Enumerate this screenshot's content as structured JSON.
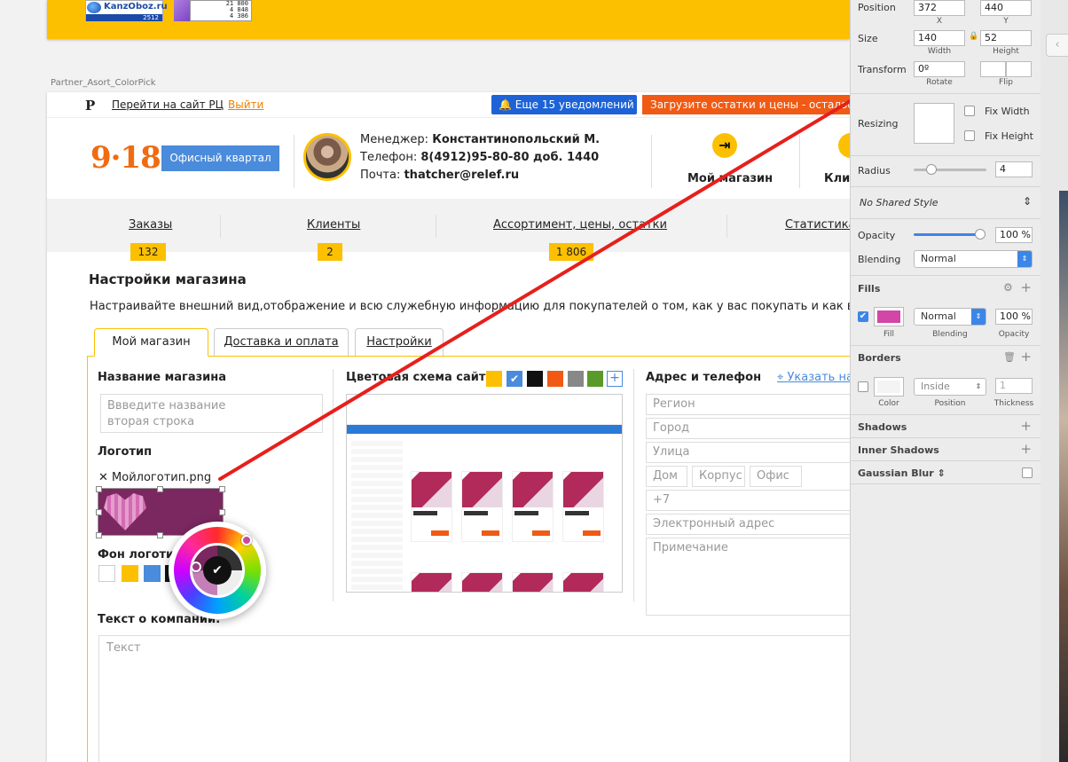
{
  "top_artboard": {
    "kanzoboz_logo": "KanzOboz.ru",
    "kanzoboz_sub": "2512",
    "stats": [
      "21 800",
      "4 848",
      "4 386"
    ]
  },
  "artboard_label": "Partner_Asort_ColorPick",
  "topbar": {
    "logo": "P",
    "goto_link": "Перейти на сайт РЦ",
    "exit_link": "Выйти",
    "notifications": "Еще 15 уведомлений",
    "upload": "Загрузите остатки и цены - осталось"
  },
  "header": {
    "brand": "9·18",
    "office_button": "Офисный квартал",
    "manager_prefix": "Менеджер: ",
    "manager_name": "Константинопольский М.",
    "phone_prefix": "Телефон: ",
    "phone": "8(4912)95-80-80 доб. 1440",
    "email_prefix": "Почта: ",
    "email": "thatcher@relef.ru",
    "my_store": "Мой магазин",
    "clients_short": "Клие"
  },
  "nav": [
    {
      "label": "Заказы",
      "count": "132"
    },
    {
      "label": "Клиенты",
      "count": "2"
    },
    {
      "label": "Ассортимент, цены, остатки",
      "count": "1 806"
    },
    {
      "label": "Статистика",
      "count": ""
    }
  ],
  "content": {
    "title": "Настройки магазина",
    "description": "Настраивайте внешний вид,отображение и всю служебную информацию для покупателей о том, как у вас покупать и как вы работаете",
    "tabs": [
      "Мой магазин",
      "Доставка и оплата",
      "Настройки"
    ],
    "store_name_label": "Название магазина",
    "store_name_placeholder_1": "Ввведите название",
    "store_name_placeholder_2": "вторая строка",
    "logo_label": "Логотип",
    "logo_file": "Мойлоготип.png",
    "logo_bg_label": "Фон логотипа",
    "color_scheme_label": "Цветовая схема сайта:",
    "address_label": "Адрес и телефон",
    "address_link": "Указать на",
    "region": "Регион",
    "city": "Город",
    "street": "Улица",
    "house": "Дом",
    "building": "Корпус",
    "office": "Офис",
    "phone": "+7",
    "email": "Электронный адрес",
    "note": "Примечание",
    "company_label": "Текст о компании:",
    "company_placeholder": "Текст"
  },
  "colors": {
    "accent_yellow": "#fcc000",
    "brand_orange": "#f06b11",
    "blue_button": "#1d63d7",
    "orange_button": "#f05a14",
    "logo_fill": "#7b2860",
    "inspector_fill": "#d246a8",
    "scheme_swatches": [
      "#fcc000",
      "#4a8bdb",
      "#111111",
      "#f05a14",
      "#888888",
      "#5a9a2a"
    ],
    "logo_bg_swatches": [
      "#ffffff",
      "#fcc000",
      "#4a8bdb",
      "#111111"
    ]
  },
  "inspector": {
    "position_label": "Position",
    "pos_x": "372",
    "pos_y": "440",
    "x_label": "X",
    "y_label": "Y",
    "size_label": "Size",
    "width": "140",
    "height": "52",
    "width_label": "Width",
    "height_label": "Height",
    "transform_label": "Transform",
    "rotate": "0º",
    "rotate_label": "Rotate",
    "flip_label": "Flip",
    "resizing_label": "Resizing",
    "fix_width": "Fix Width",
    "fix_height": "Fix Height",
    "radius_label": "Radius",
    "radius": "4",
    "shared_style": "No Shared Style",
    "opacity_label": "Opacity",
    "opacity": "100 %",
    "blending_label": "Blending",
    "blending": "Normal",
    "fills_label": "Fills",
    "fill_label": "Fill",
    "fill_blending": "Normal",
    "fill_blending_label": "Blending",
    "fill_opacity": "100 %",
    "fill_opacity_label": "Opacity",
    "borders_label": "Borders",
    "border_color_label": "Color",
    "border_position": "Inside",
    "border_position_label": "Position",
    "border_thickness": "1",
    "border_thickness_label": "Thickness",
    "shadows_label": "Shadows",
    "inner_shadows_label": "Inner Shadows",
    "gaussian_blur_label": "Gaussian Blur"
  }
}
